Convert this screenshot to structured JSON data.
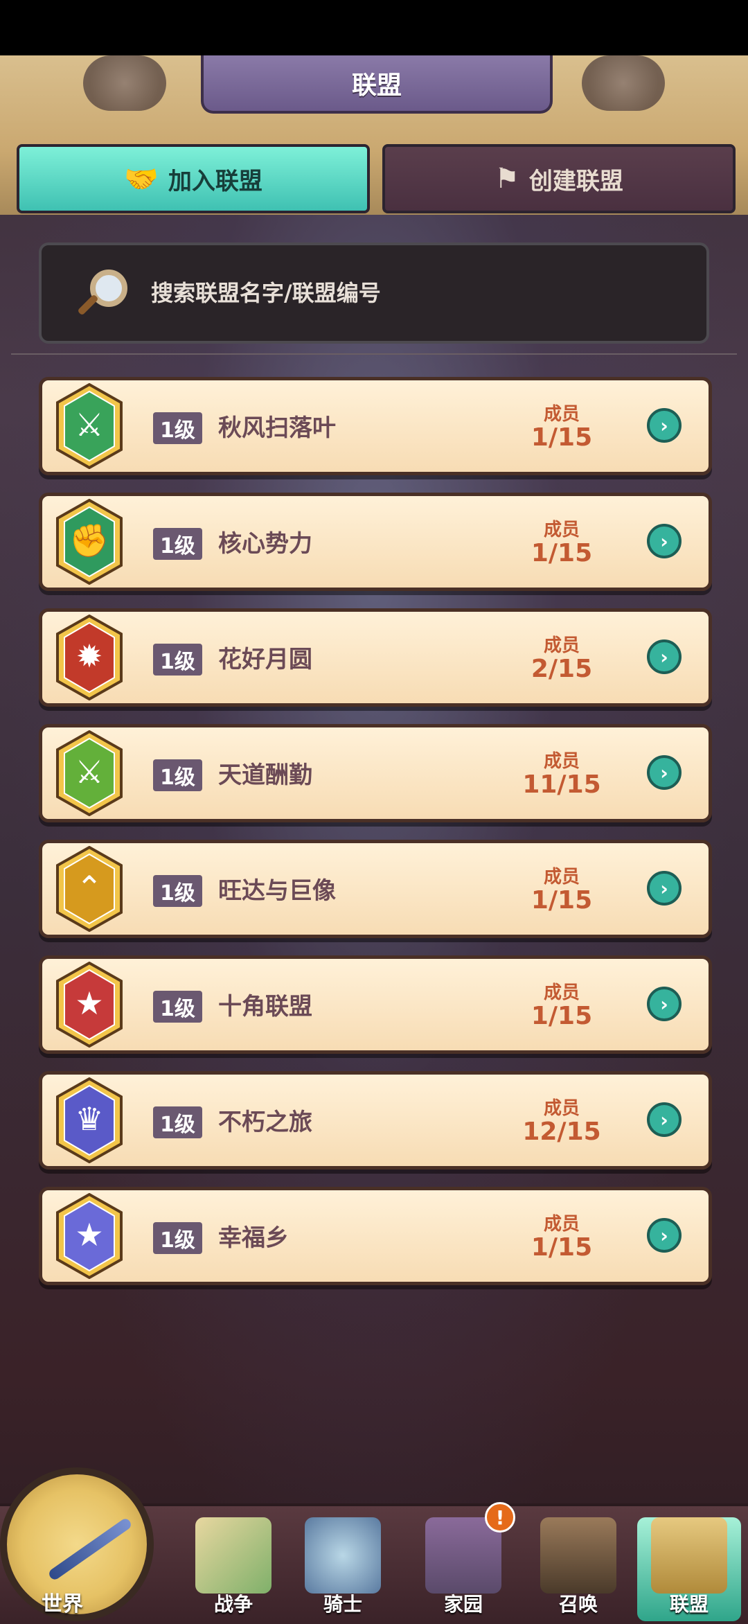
{
  "header": {
    "title": "联盟"
  },
  "tabs": [
    {
      "label": "加入联盟",
      "icon": "handshake-icon",
      "active": true
    },
    {
      "label": "创建联盟",
      "icon": "flag-icon",
      "active": false
    }
  ],
  "search": {
    "placeholder": "搜索联盟名字/联盟编号"
  },
  "alliances": [
    {
      "level": "1级",
      "name": "秋风扫落叶",
      "members_label": "成员",
      "members": "1/15",
      "emblem": "crossed-swords-icon",
      "color": "#39a35a"
    },
    {
      "level": "1级",
      "name": "核心势力",
      "members_label": "成员",
      "members": "1/15",
      "emblem": "fist-icon",
      "color": "#2f9a5e"
    },
    {
      "level": "1级",
      "name": "花好月圆",
      "members_label": "成员",
      "members": "2/15",
      "emblem": "sun-icon",
      "color": "#c23a2a"
    },
    {
      "level": "1级",
      "name": "天道酬勤",
      "members_label": "成员",
      "members": "11/15",
      "emblem": "crossed-swords-icon",
      "color": "#63b03a"
    },
    {
      "level": "1级",
      "name": "旺达与巨像",
      "members_label": "成员",
      "members": "1/15",
      "emblem": "chevrons-icon",
      "color": "#d69a1e"
    },
    {
      "level": "1级",
      "name": "十角联盟",
      "members_label": "成员",
      "members": "1/15",
      "emblem": "star-icon",
      "color": "#c63a3a"
    },
    {
      "level": "1级",
      "name": "不朽之旅",
      "members_label": "成员",
      "members": "12/15",
      "emblem": "crown-icon",
      "color": "#5a5ac8"
    },
    {
      "level": "1级",
      "name": "幸福乡",
      "members_label": "成员",
      "members": "1/15",
      "emblem": "star-icon",
      "color": "#6a6ad8"
    }
  ],
  "bottom_nav": [
    {
      "label": "世界",
      "icon": "compass-icon"
    },
    {
      "label": "战争",
      "icon": "map-icon"
    },
    {
      "label": "骑士",
      "icon": "knight-icon"
    },
    {
      "label": "家园",
      "icon": "house-icon",
      "badge": "!"
    },
    {
      "label": "召唤",
      "icon": "train-icon"
    },
    {
      "label": "联盟",
      "icon": "guild-icon",
      "active": true
    }
  ]
}
